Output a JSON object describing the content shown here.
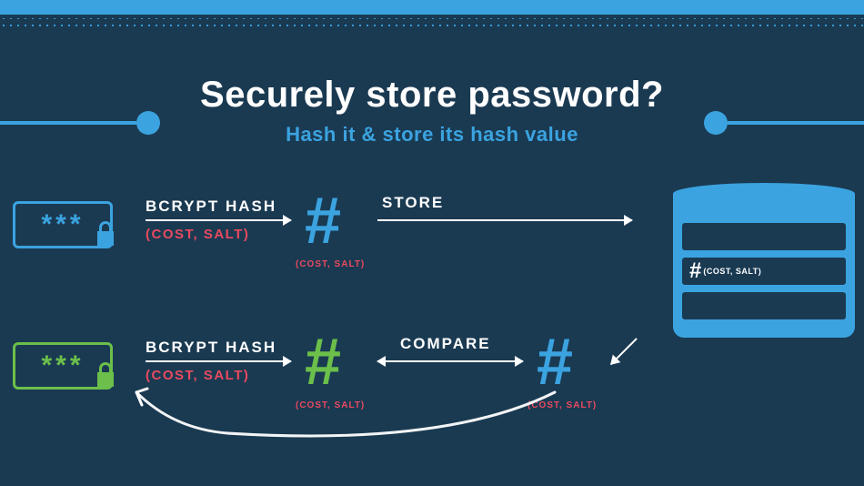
{
  "header": {
    "title": "Securely store password?",
    "subtitle": "Hash it & store its hash value"
  },
  "row1": {
    "password_display": "***",
    "hash_label": "BCRYPT HASH",
    "params": "(COST, SALT)",
    "hash_params_small": "(COST, SALT)",
    "store_label": "STORE"
  },
  "row2": {
    "password_display": "***",
    "hash_label": "BCRYPT HASH",
    "params": "(COST, SALT)",
    "hash_params_small": "(COST, SALT)",
    "compare_label": "COMPARE",
    "retrieved_params_small": "(COST, SALT)"
  },
  "database": {
    "stored_hash_label": "#",
    "stored_params": "(COST, SALT)"
  },
  "colors": {
    "background": "#1a3a52",
    "accent_blue": "#3ba3e0",
    "accent_green": "#6bbf4a",
    "accent_red": "#e84a5f"
  }
}
